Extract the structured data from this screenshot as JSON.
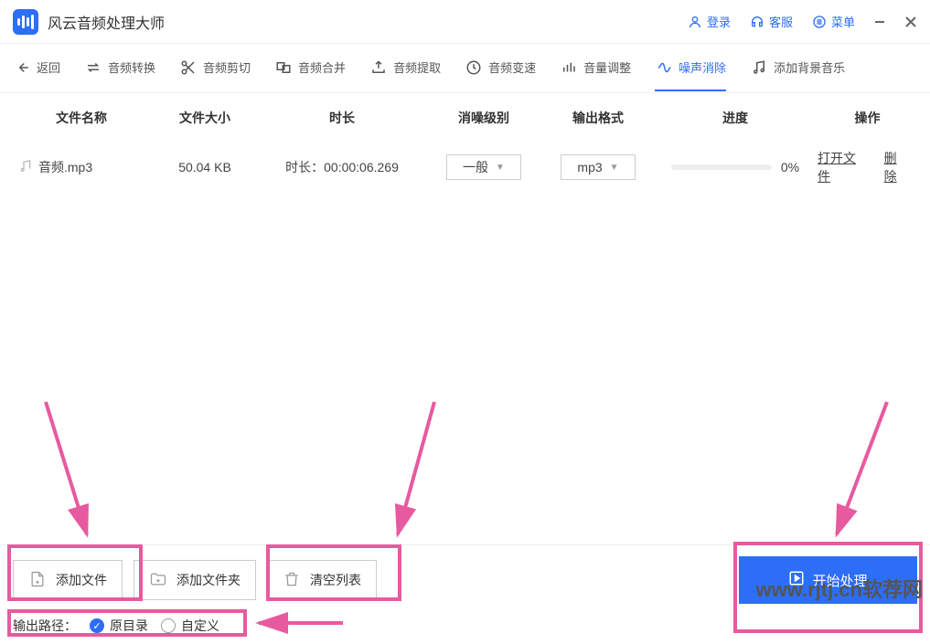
{
  "app": {
    "title": "风云音频处理大师"
  },
  "titlebar": {
    "login": "登录",
    "service": "客服",
    "menu": "菜单"
  },
  "toolbar": {
    "back": "返回",
    "convert": "音频转换",
    "cut": "音频剪切",
    "merge": "音频合并",
    "extract": "音频提取",
    "speed": "音频变速",
    "volume": "音量调整",
    "denoise": "噪声消除",
    "bgm": "添加背景音乐"
  },
  "columns": {
    "name": "文件名称",
    "size": "文件大小",
    "duration": "时长",
    "level": "消噪级别",
    "format": "输出格式",
    "progress": "进度",
    "op": "操作"
  },
  "rows": [
    {
      "name": "音频.mp3",
      "size": "50.04 KB",
      "duration": "时长：00:00:06.269",
      "level": "一般",
      "format": "mp3",
      "progress": "0%",
      "open": "打开文件",
      "delete": "删除"
    }
  ],
  "bottom": {
    "add_file": "添加文件",
    "add_folder": "添加文件夹",
    "clear": "清空列表",
    "start": "开始处理",
    "output_label": "输出路径：",
    "radio_orig": "原目录",
    "radio_custom": "自定义"
  },
  "watermark": "www.rjtj.cn软荐网"
}
